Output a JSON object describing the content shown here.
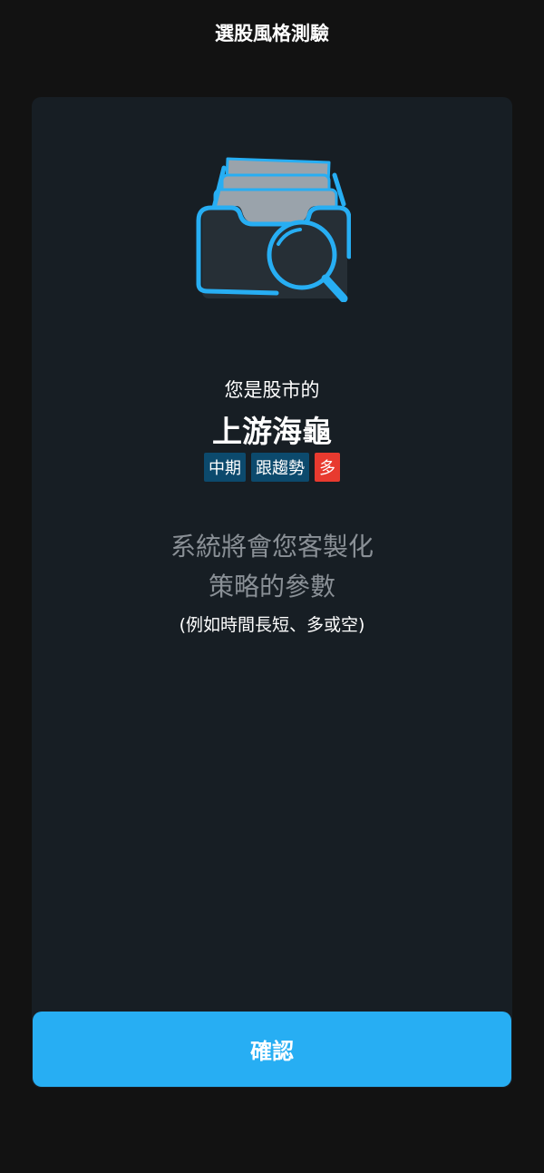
{
  "header": {
    "title": "選股風格測驗"
  },
  "result": {
    "intro": "您是股市的",
    "type_name": "上游海龜",
    "tags": [
      {
        "label": "中期",
        "color": "#0c4a6d"
      },
      {
        "label": "跟趨勢",
        "color": "#0c4a6d"
      },
      {
        "label": "多",
        "color": "#e83a2f"
      }
    ],
    "description_line1": "系統將會您客製化",
    "description_line2": "策略的參數",
    "hint": "(例如時間長短、多或空)"
  },
  "illustration": {
    "icon": "folder-search-icon",
    "accent": "#27aef3"
  },
  "actions": {
    "confirm_label": "確認"
  }
}
